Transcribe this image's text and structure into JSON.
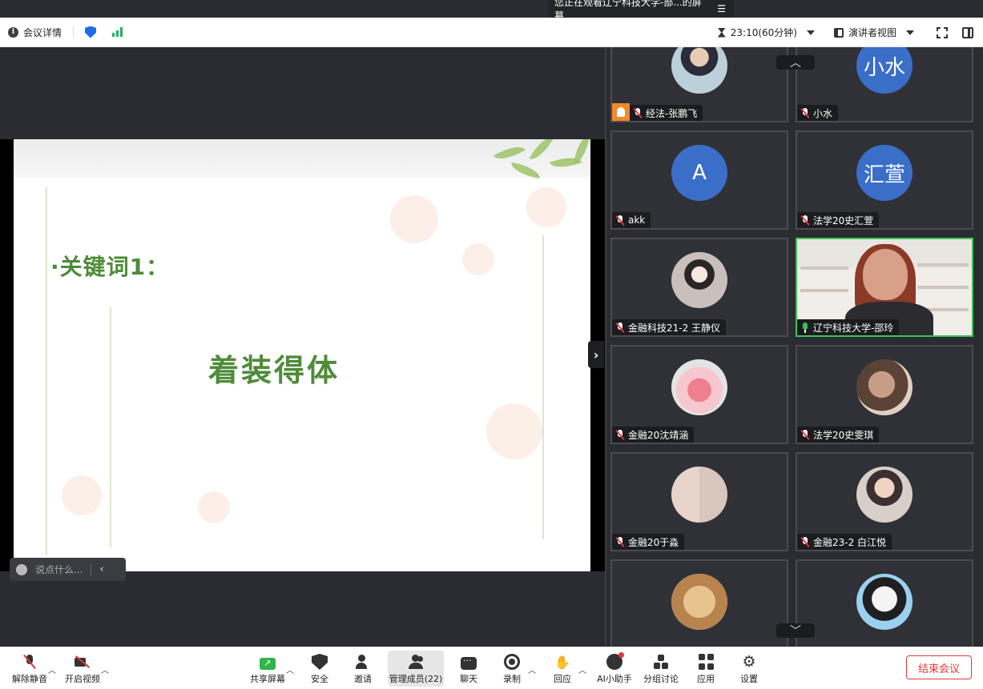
{
  "share_banner": {
    "text": "您正在观看辽宁科技大学-部...的屏幕",
    "menu_icon": "list-icon"
  },
  "topbar": {
    "meeting_info": "会议详情",
    "timer": "23:10(60分钟)",
    "view_mode": "演讲者视图"
  },
  "slide": {
    "keyword": "·关键词1：",
    "main_text": "着装得体"
  },
  "chat_input": {
    "placeholder": "说点什么..."
  },
  "gallery": {
    "participants": [
      {
        "name": "经法-张鹏飞",
        "avatar": "photo",
        "muted": true,
        "host": true
      },
      {
        "name": "小水",
        "avatar_text": "小水",
        "muted": true
      },
      {
        "name": "akk",
        "avatar_text": "A",
        "muted": true
      },
      {
        "name": "法学20史汇萱",
        "avatar_text": "汇萱",
        "muted": true
      },
      {
        "name": "金融科技21-2 王静仪",
        "avatar": "photo",
        "muted": true
      },
      {
        "name": "辽宁科技大学-邵玲",
        "avatar": "video",
        "muted": false,
        "speaking": true
      },
      {
        "name": "金融20沈靖涵",
        "avatar": "photo",
        "muted": true
      },
      {
        "name": "法学20史雯琪",
        "avatar": "photo",
        "muted": true
      },
      {
        "name": "金融20于淼",
        "avatar": "photo",
        "muted": true
      },
      {
        "name": "金融23-2 白江悦",
        "avatar": "photo",
        "muted": true
      },
      {
        "name": "",
        "avatar": "photo",
        "muted": true
      },
      {
        "name": "",
        "avatar": "photo",
        "muted": true
      }
    ]
  },
  "toolbar": {
    "unmute": "解除静音",
    "start_video": "开启视频",
    "share_screen": "共享屏幕",
    "security": "安全",
    "invite": "邀请",
    "participants": "管理成员(22)",
    "chat": "聊天",
    "record": "录制",
    "reactions": "回应",
    "ai_assistant": "AI小助手",
    "breakout": "分组讨论",
    "apps": "应用",
    "settings": "设置",
    "end_meeting": "结束会议"
  },
  "colors": {
    "accent_green": "#3ac352",
    "end_red": "#e0383c",
    "avatar_blue": "#3a6ec8",
    "slide_text_green": "#4f8b3a"
  }
}
